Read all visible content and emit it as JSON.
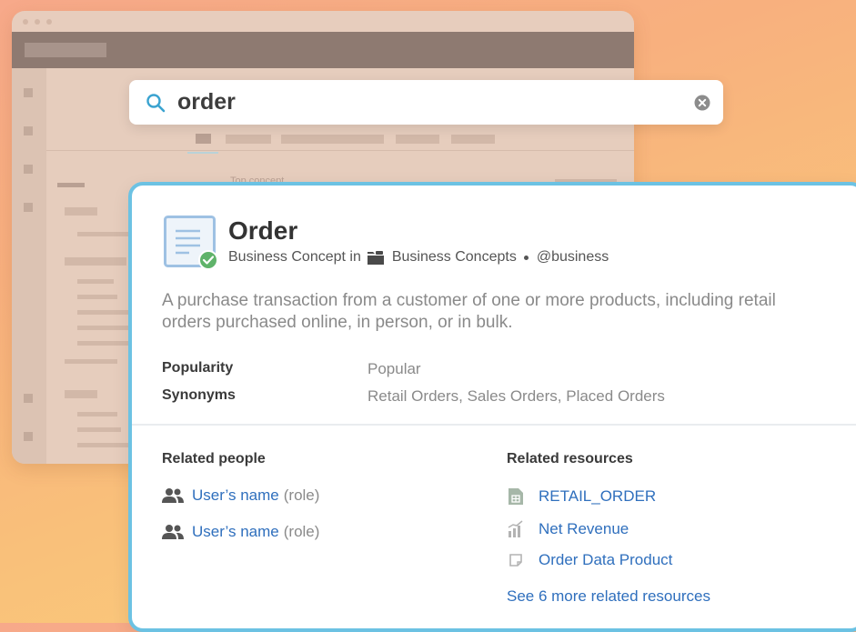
{
  "search": {
    "query": "order"
  },
  "card": {
    "title": "Order",
    "type_label": "Business Concept in",
    "collection": "Business Concepts",
    "handle": "@business",
    "description": "A purchase transaction from a customer of one or more products, including retail orders purchased online, in person, or in bulk.",
    "properties": [
      {
        "label": "Popularity",
        "value": "Popular"
      },
      {
        "label": "Synonyms",
        "value": "Retail Orders, Sales Orders, Placed Orders"
      }
    ],
    "related_people": {
      "title": "Related people",
      "items": [
        {
          "name": "User’s name",
          "role": "(role)"
        },
        {
          "name": "User’s name",
          "role": "(role)"
        }
      ]
    },
    "related_resources": {
      "title": "Related resources",
      "items": [
        {
          "label": "RETAIL_ORDER",
          "icon": "table-icon"
        },
        {
          "label": "Net Revenue",
          "icon": "metric-chart-icon"
        },
        {
          "label": "Order Data Product",
          "icon": "data-product-icon"
        }
      ],
      "more_link": "See 6 more related resources"
    }
  },
  "background": {
    "faint_text": "Top concept"
  },
  "colors": {
    "accent_border": "#6cc2e3",
    "link": "#2f6fbd",
    "verified": "#5fb36a",
    "search_icon": "#3aa3d0"
  }
}
